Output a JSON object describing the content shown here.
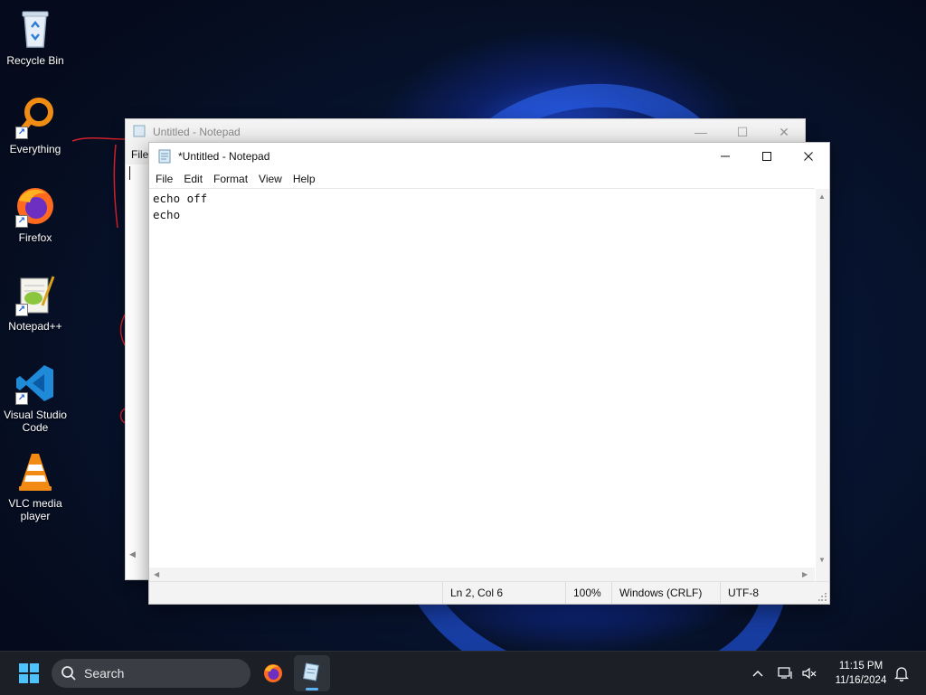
{
  "desktop": {
    "icons": [
      {
        "label": "Recycle Bin",
        "icon": "recycle-bin-icon"
      },
      {
        "label": "Everything",
        "icon": "everything-search-icon"
      },
      {
        "label": "Firefox",
        "icon": "firefox-icon"
      },
      {
        "label": "Notepad++",
        "icon": "notepad-plus-plus-icon"
      },
      {
        "label": "Visual Studio Code",
        "icon": "vscode-icon"
      },
      {
        "label": "VLC media player",
        "icon": "vlc-icon"
      }
    ]
  },
  "back_window": {
    "title": "Untitled - Notepad",
    "menu_first": "File"
  },
  "front_window": {
    "title": "*Untitled - Notepad",
    "menu": [
      "File",
      "Edit",
      "Format",
      "View",
      "Help"
    ],
    "editor_lines": [
      "echo off",
      "echo"
    ],
    "status": {
      "position": "Ln 2, Col 6",
      "zoom": "100%",
      "line_ending": "Windows (CRLF)",
      "encoding": "UTF-8"
    }
  },
  "taskbar": {
    "search_placeholder": "Search",
    "time": "11:15 PM",
    "date": "11/16/2024"
  },
  "colors": {
    "taskbar_bg": "#1c1f26",
    "accent": "#5fb2f2",
    "annotation_red": "#d0202a"
  }
}
